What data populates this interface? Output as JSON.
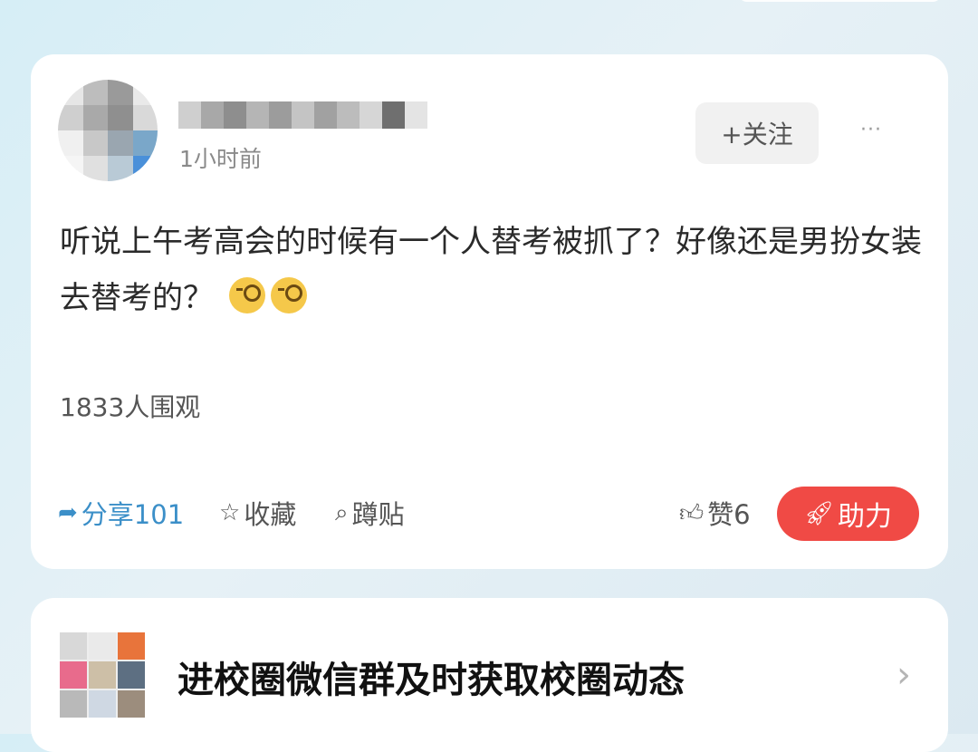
{
  "post": {
    "time": "1小时前",
    "follow_label": "+关注",
    "more_label": "···",
    "text": "听说上午考高会的时候有一个人替考被抓了？好像还是男扮女装去替考的？",
    "emoji": "monocle-face",
    "views": "1833人围观",
    "actions": {
      "share": "分享101",
      "favorite": "收藏",
      "squat": "蹲贴",
      "like": "赞6",
      "boost": "助力"
    }
  },
  "banner": {
    "text": "进校圈微信群及时获取校圈动态",
    "chevron": "›"
  },
  "colors": {
    "accent_blue": "#3b8fc8",
    "boost_red": "#f04a45"
  }
}
